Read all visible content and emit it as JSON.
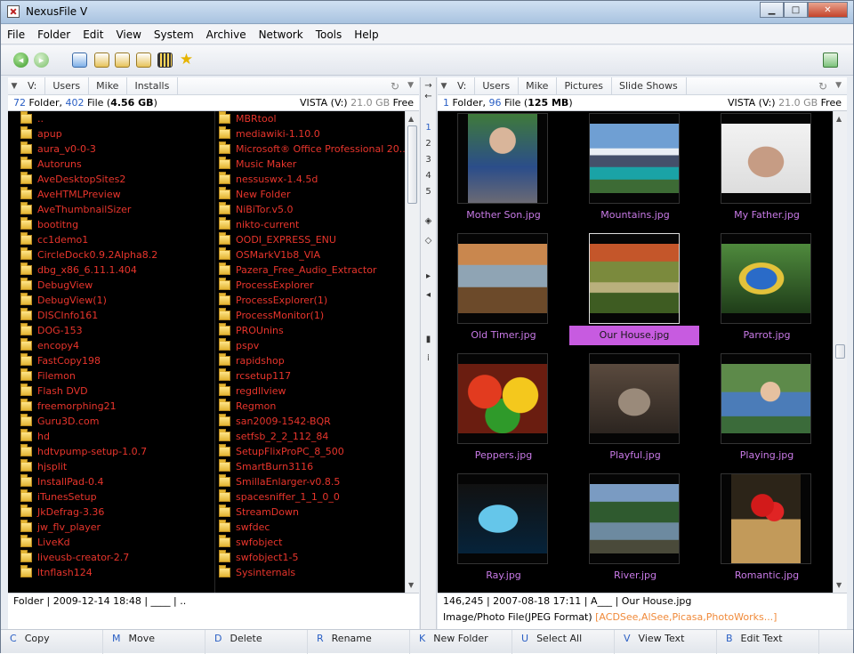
{
  "window": {
    "title": "NexusFile V"
  },
  "menu": [
    "File",
    "Folder",
    "Edit",
    "View",
    "System",
    "Archive",
    "Network",
    "Tools",
    "Help"
  ],
  "left": {
    "breadcrumb": [
      "V:",
      "Users",
      "Mike",
      "Installs"
    ],
    "summary": {
      "folders": "72",
      "folder_label": " Folder, ",
      "files": "402",
      "file_label": " File (",
      "size": "4.56 GB",
      "close": ")",
      "drive": "VISTA (V:) ",
      "free": "21.0 GB",
      "free_label": " Free"
    },
    "col1": [
      "..",
      "apup",
      "aura_v0-0-3",
      "Autoruns",
      "AveDesktopSites2",
      "AveHTMLPreview",
      "AveThumbnailSizer",
      "bootitng",
      "cc1demo1",
      "CircleDock0.9.2Alpha8.2",
      "dbg_x86_6.11.1.404",
      "DebugView",
      "DebugView(1)",
      "DISCInfo161",
      "DOG-153",
      "encopy4",
      "FastCopy198",
      "Filemon",
      "Flash DVD",
      "freemorphing21",
      "Guru3D.com",
      "hd",
      "hdtvpump-setup-1.0.7",
      "hjsplit",
      "InstallPad-0.4",
      "iTunesSetup",
      "JkDefrag-3.36",
      "jw_flv_player",
      "LiveKd",
      "liveusb-creator-2.7",
      "ltnflash124"
    ],
    "col2": [
      "MBRtool",
      "mediawiki-1.10.0",
      "Microsoft® Office Professional 20...",
      "Music Maker",
      "nessuswx-1.4.5d",
      "New Folder",
      "NiBiTor.v5.0",
      "nikto-current",
      "OODI_EXPRESS_ENU",
      "OSMarkV1b8_VIA",
      "Pazera_Free_Audio_Extractor",
      "ProcessExplorer",
      "ProcessExplorer(1)",
      "ProcessMonitor(1)",
      "PROUnins",
      "pspv",
      "rapidshop",
      "rcsetup117",
      "regdllview",
      "Regmon",
      "san2009-1542-BQR",
      "setfsb_2_2_112_84",
      "SetupFlixProPC_8_500",
      "SmartBurn3116",
      "SmillaEnlarger-v0.8.5",
      "spacesniffer_1_1_0_0",
      "StreamDown",
      "swfdec",
      "swfobject",
      "swfobject1-5",
      "Sysinternals"
    ],
    "status": "Folder | 2009-12-14 18:48 | ____ | .."
  },
  "right": {
    "breadcrumb": [
      "V:",
      "Users",
      "Mike",
      "Pictures",
      "Slide Shows"
    ],
    "summary": {
      "folders": "1",
      "folder_label": " Folder, ",
      "files": "96",
      "file_label": " File (",
      "size": "125 MB",
      "close": ")",
      "drive": "VISTA (V:) ",
      "free": "21.0 GB",
      "free_label": " Free"
    },
    "thumbs": [
      "Mother Son.jpg",
      "Mountains.jpg",
      "My Father.jpg",
      "Old Timer.jpg",
      "Our House.jpg",
      "Parrot.jpg",
      "Peppers.jpg",
      "Playful.jpg",
      "Playing.jpg",
      "Ray.jpg",
      "River.jpg",
      "Romantic.jpg"
    ],
    "selected": "Our House.jpg",
    "status1": "146,245 | 2007-08-18 17:11 | A___ | Our House.jpg",
    "status2": "Image/Photo File(JPEG Format)",
    "status2_apps": "[ACDSee,AlSee,Picasa,PhotoWorks...]"
  },
  "middle": {
    "numbers": [
      "1",
      "2",
      "3",
      "4",
      "5"
    ]
  },
  "fkeys": [
    {
      "key": "C",
      "label": "Copy"
    },
    {
      "key": "M",
      "label": "Move"
    },
    {
      "key": "D",
      "label": "Delete"
    },
    {
      "key": "R",
      "label": "Rename"
    },
    {
      "key": "K",
      "label": "New Folder"
    },
    {
      "key": "U",
      "label": "Select All"
    },
    {
      "key": "V",
      "label": "View Text"
    },
    {
      "key": "B",
      "label": "Edit Text"
    }
  ]
}
